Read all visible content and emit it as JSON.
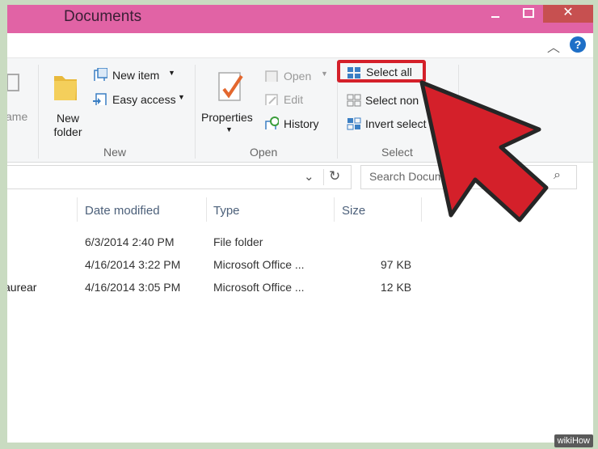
{
  "window": {
    "title": "Documents",
    "close": "✕"
  },
  "ribbon": {
    "clipped_label": "ame",
    "new_folder": "New folder",
    "new_item": "New item",
    "easy_access": "Easy access",
    "group_new": "New",
    "properties": "Properties",
    "open": "Open",
    "edit": "Edit",
    "history": "History",
    "group_open": "Open",
    "select_all": "Select all",
    "select_none": "Select non",
    "invert_selection": "Invert select",
    "group_select": "Select",
    "help": "?"
  },
  "address": {
    "search_placeholder": "Search Docum"
  },
  "columns": [
    "Date modified",
    "Type",
    "Size"
  ],
  "files": [
    {
      "name": "",
      "date": "6/3/2014 2:40 PM",
      "type": "File folder",
      "size": ""
    },
    {
      "name": "",
      "date": "4/16/2014 3:22 PM",
      "type": "Microsoft Office ...",
      "size": "97 KB"
    },
    {
      "name": "aurear",
      "date": "4/16/2014 3:05 PM",
      "type": "Microsoft Office ...",
      "size": "12 KB"
    }
  ],
  "colors": {
    "titlebar": "#e163a5",
    "highlight": "#d4202a",
    "arrow": "#d4202a"
  },
  "watermark": "wikiHow"
}
